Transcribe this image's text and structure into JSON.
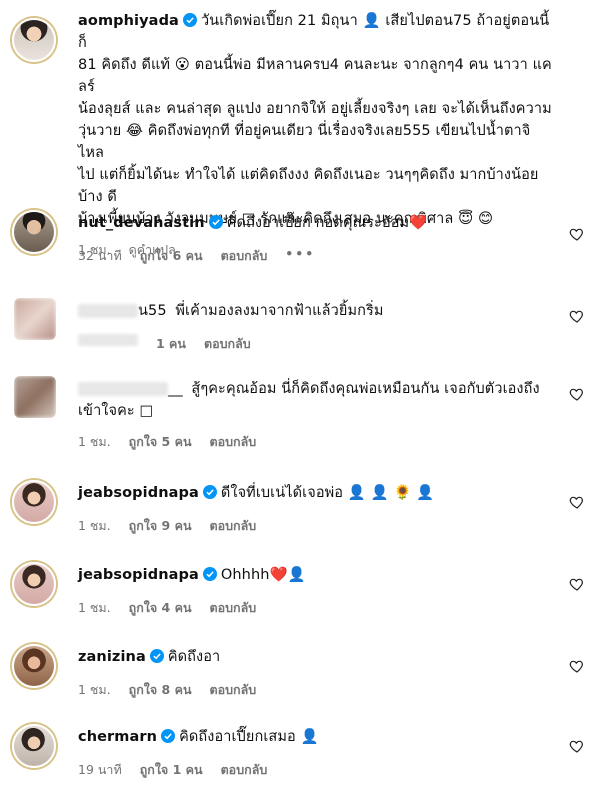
{
  "comments": [
    {
      "username": "aomphiyada",
      "verified": true,
      "text_lines": [
        "วันเกิดพ่อเปี๊ยก 21 มิถุนา 👤 เสียไปตอน75 ถ้าอยู่ตอนนี้ก็",
        "81 คิดถึง ดีแท้ 😮 ตอนนี้พ่อ มีหลานครบ4 คนละนะ จากลูกๆ4 คน นาวา แคลร์",
        "น้องลุยส์ และ คนล่าสุด ลูแปง อยากจิให้ อยู่เลี้ยงจริงๆ เลย จะได้เห็นถึงความ",
        "วุ่นวาย 😂 คิดถึงพ่อทุกที ที่อยู่คนเดียว นี่เรื่องจริงเลย555 เขียนไปน้ำตาจิไหล",
        "ไป แต่ก็ยิ้มได้นะ ทำใจได้ แต่คิดถึงงง คิดถึงเนอะ วนๆๆคิดถึง มากบ้างน้อยบ้าง ดี",
        "บ้างเพี้ยนบ้าง วังวนมนุษย์ □ รักและคิดถึงเสมอ นะคุณพิศาล 😇 😊"
      ],
      "time": "1 ชม.",
      "likes": "",
      "reply": "",
      "translate": "ดูคำแปล",
      "heart": false
    },
    {
      "username": "nut_devahastin",
      "verified": true,
      "text": "คิดถึงอาเปี๊ยก กอดคุณระอ้อม❤️",
      "time": "32 นาที",
      "likes": "ถูกใจ 6 คน",
      "reply": "ตอบกลับ",
      "more": "•••",
      "heart": true
    },
    {
      "username": "",
      "username_suffix": "น55",
      "verified": false,
      "blurred": true,
      "text": "พี่เค้ามองลงมาจากฟ้าแล้วยิ้มกริ่ม",
      "time": "",
      "likes": "1 คน",
      "reply": "ตอบกลับ",
      "heart": true
    },
    {
      "username": "",
      "username_suffix": "__",
      "verified": false,
      "blurred": true,
      "text_lines": [
        "สู้ๆคะคุณอ้อม นี่ก็คิดถึงคุณพ่อเหมือนกัน เจอกับตัวเองถึง",
        "เข้าใจคะ □"
      ],
      "time": "1 ชม.",
      "likes": "ถูกใจ 5 คน",
      "reply": "ตอบกลับ",
      "heart": true
    },
    {
      "username": "jeabsopidnapa",
      "verified": true,
      "text": "ดีใจที่เบเน่ได้เจอพ่อ 👤 👤 🌻 👤",
      "time": "1 ชม.",
      "likes": "ถูกใจ 9 คน",
      "reply": "ตอบกลับ",
      "heart": true
    },
    {
      "username": "jeabsopidnapa",
      "verified": true,
      "text": "Ohhhh❤️👤",
      "time": "1 ชม.",
      "likes": "ถูกใจ 4 คน",
      "reply": "ตอบกลับ",
      "heart": true
    },
    {
      "username": "zanizina",
      "verified": true,
      "text": "คิดถึงอา",
      "time": "1 ชม.",
      "likes": "ถูกใจ 8 คน",
      "reply": "ตอบกลับ",
      "heart": true
    },
    {
      "username": "chermarn",
      "verified": true,
      "text": "คิดถึงอาเปี๊ยกเสมอ 👤",
      "time": "19 นาที",
      "likes": "ถูกใจ 1 คน",
      "reply": "ตอบกลับ",
      "heart": true
    }
  ],
  "colors": {
    "verified_blue": "#0095f6",
    "meta_gray": "#737373",
    "heart_red": "#e0245e"
  }
}
